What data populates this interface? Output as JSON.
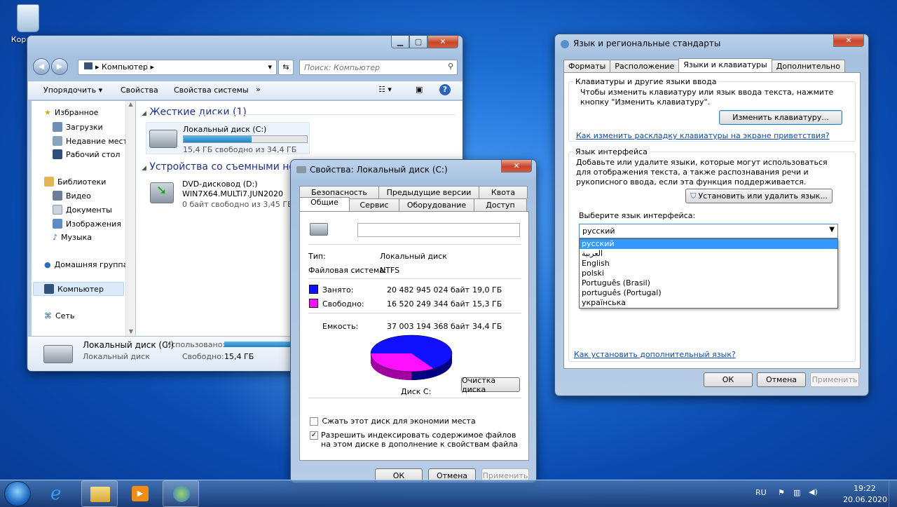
{
  "desktop": {
    "recycle_bin_label": "Корзина"
  },
  "explorer": {
    "address": "Компьютер",
    "search_placeholder": "Поиск: Компьютер",
    "toolbar": {
      "organize": "Упорядочить",
      "properties": "Свойства",
      "system_properties": "Свойства системы",
      "more": "»"
    },
    "nav": {
      "favorites": "Избранное",
      "downloads": "Загрузки",
      "recent": "Недавние места",
      "desktop": "Рабочий стол",
      "libraries": "Библиотеки",
      "video": "Видео",
      "documents": "Документы",
      "images": "Изображения",
      "music": "Музыка",
      "homegroup": "Домашняя группа",
      "computer": "Компьютер",
      "network": "Сеть"
    },
    "hard_disks_header": "Жесткие диски (1)",
    "drive_c": {
      "name": "Локальный диск (C:)",
      "free": "15,4 ГБ свободно из 34,4 ГБ",
      "used_fraction": 0.55
    },
    "removable_header": "Устройства со съемными носи",
    "dvd": {
      "name": "DVD-дисковод (D:)",
      "label": "WIN7X64.MULTi7.JUN2020",
      "free": "0 байт свободно из 3,45 ГБ"
    },
    "details": {
      "name": "Локальный диск (C:)",
      "type": "Локальный диск",
      "used_label": "Использовано:",
      "free_label": "Свободно:",
      "free_value": "15,4 ГБ"
    }
  },
  "props": {
    "title": "Свойства: Локальный диск (C:)",
    "tabs_top": [
      "Безопасность",
      "Предыдущие версии",
      "Квота"
    ],
    "tabs_bottom": [
      "Общие",
      "Сервис",
      "Оборудование",
      "Доступ"
    ],
    "type_label": "Тип:",
    "type_value": "Локальный диск",
    "fs_label": "Файловая система:",
    "fs_value": "NTFS",
    "used_label": "Занято:",
    "used_bytes": "20 482 945 024 байт",
    "used_gb": "19,0 ГБ",
    "free_label": "Свободно:",
    "free_bytes": "16 520 249 344 байт",
    "free_gb": "15,3 ГБ",
    "cap_label": "Емкость:",
    "cap_bytes": "37 003 194 368 байт",
    "cap_gb": "34,4 ГБ",
    "disk_label": "Диск C:",
    "cleanup": "Очистка диска",
    "compress": "Сжать этот диск для экономии места",
    "index": "Разрешить индексировать содержимое файлов на этом диске в дополнение к свойствам файла",
    "ok": "ОК",
    "cancel": "Отмена",
    "apply": "Применить",
    "colors": {
      "used": "#1010ff",
      "free": "#ff10ff"
    }
  },
  "region": {
    "title": "Язык и региональные стандарты",
    "tabs": [
      "Форматы",
      "Расположение",
      "Языки и клавиатуры",
      "Дополнительно"
    ],
    "kb_group": "Клавиатуры и другие языки ввода",
    "kb_text": "Чтобы изменить клавиатуру или язык ввода текста, нажмите кнопку \"Изменить клавиатуру\".",
    "kb_button": "Изменить клавиатуру...",
    "kb_link": "Как изменить раскладку клавиатуры на экране приветствия?",
    "ui_group": "Язык интерфейса",
    "ui_text": "Добавьте или удалите языки, которые могут использоваться для отображения текста, а также распознавания речи и рукописного ввода, если эта функция поддерживается.",
    "install_button": "Установить или удалить язык...",
    "choose_label": "Выберите язык интерфейса:",
    "selected": "русский",
    "options": [
      "русский",
      "العربية",
      "English",
      "polski",
      "Português (Brasil)",
      "português (Portugal)",
      "українська"
    ],
    "add_link": "Как установить дополнительный язык?",
    "ok": "ОК",
    "cancel": "Отмена",
    "apply": "Применить"
  },
  "taskbar": {
    "lang": "RU",
    "time": "19:22",
    "date": "20.06.2020"
  }
}
